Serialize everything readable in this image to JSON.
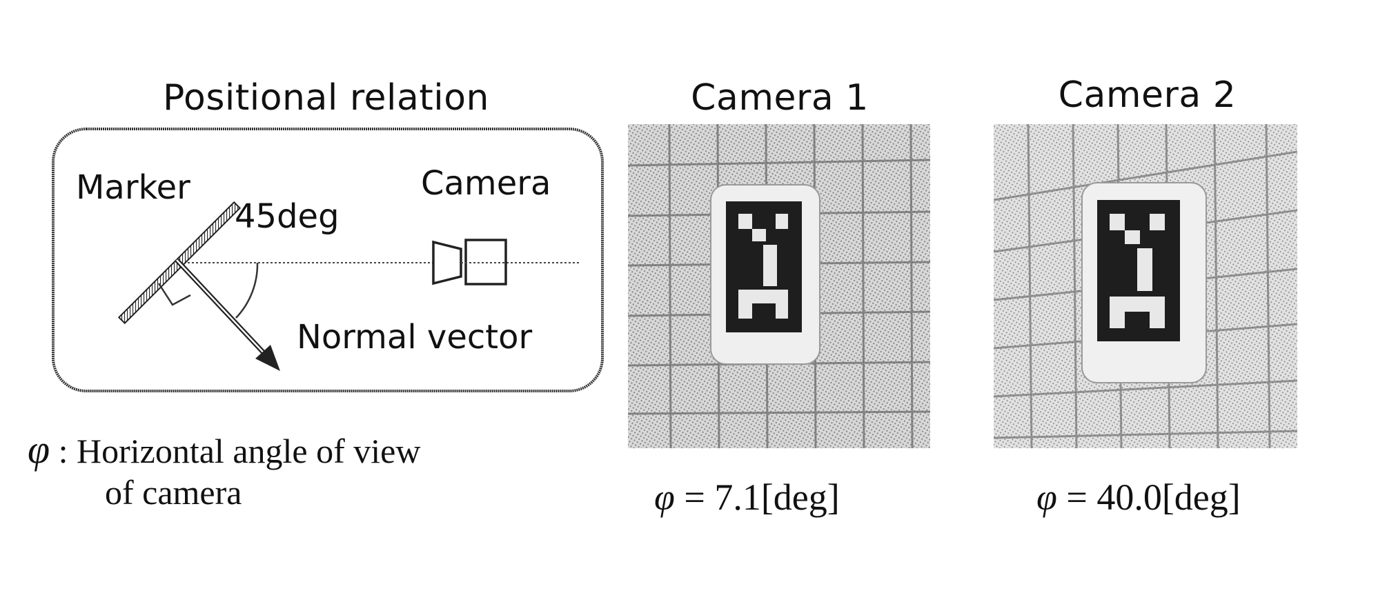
{
  "figure": {
    "positional_relation": {
      "title": "Positional relation",
      "labels": {
        "marker": "Marker",
        "angle": "45deg",
        "camera": "Camera",
        "normal_vector": "Normal vector"
      }
    },
    "legend": {
      "symbol": "φ",
      "separator": " : ",
      "text_line1": "Horizontal angle of view",
      "text_line2": "of camera"
    },
    "cameras": [
      {
        "title": "Camera 1",
        "caption_symbol": "φ",
        "caption_value": " = 7.1[deg]"
      },
      {
        "title": "Camera 2",
        "caption_symbol": "φ",
        "caption_value": " = 40.0[deg]"
      }
    ]
  }
}
